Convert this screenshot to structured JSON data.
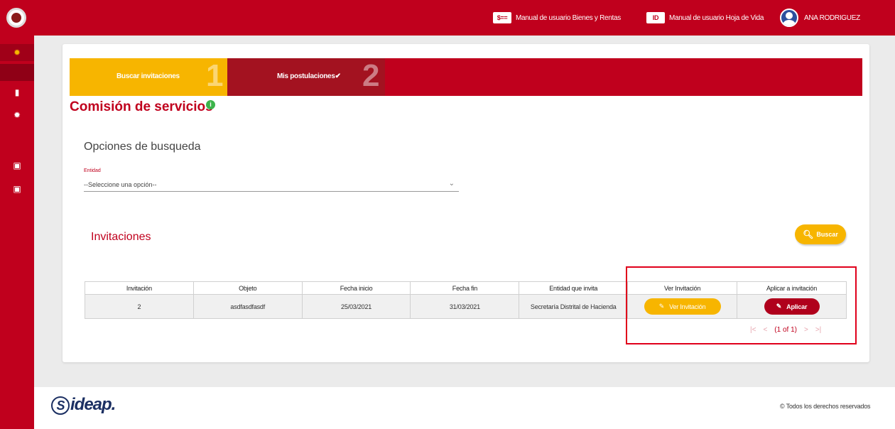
{
  "header": {
    "manual_bienes_icon": "$==",
    "manual_bienes_label": "Manual de usuario Bienes y Rentas",
    "manual_hoja_icon": "ID",
    "manual_hoja_label": "Manual de usuario Hoja de Vida",
    "user_name": "ANA RODRIGUEZ"
  },
  "steps": [
    {
      "label": "Buscar invitaciones",
      "number": "1"
    },
    {
      "label": "Mis postulaciones✔",
      "number": "2"
    }
  ],
  "page": {
    "title": "Comisión de servicios",
    "info_icon": "i"
  },
  "search": {
    "section_title": "Opciones de busqueda",
    "entidad_label": "Entidad",
    "entidad_value": "--Seleccione una opción--"
  },
  "invitations": {
    "title": "Invitaciones",
    "search_button": "Buscar",
    "columns": [
      "Invitación",
      "Objeto",
      "Fecha inicio",
      "Fecha fin",
      "Entidad que invita",
      "Ver Invitación",
      "Aplicar a invitación"
    ],
    "rows": [
      {
        "invitacion": "2",
        "objeto": "asdfasdfasdf",
        "fecha_inicio": "25/03/2021",
        "fecha_fin": "31/03/2021",
        "entidad": "Secretaría Distrital de Hacienda",
        "ver_label": "Ver Invitación",
        "aplicar_label": "Aplicar"
      }
    ],
    "pager": {
      "first": "|<",
      "prev": "<",
      "status": "(1 of 1)",
      "next": ">",
      "last": ">|"
    }
  },
  "footer": {
    "logo_text": "ideap.",
    "logo_letter": "S",
    "rights": "© Todos los derechos reservados"
  },
  "colors": {
    "brand_red": "#c0001d",
    "accent_yellow": "#f7b500",
    "highlight": "#e0001b"
  }
}
